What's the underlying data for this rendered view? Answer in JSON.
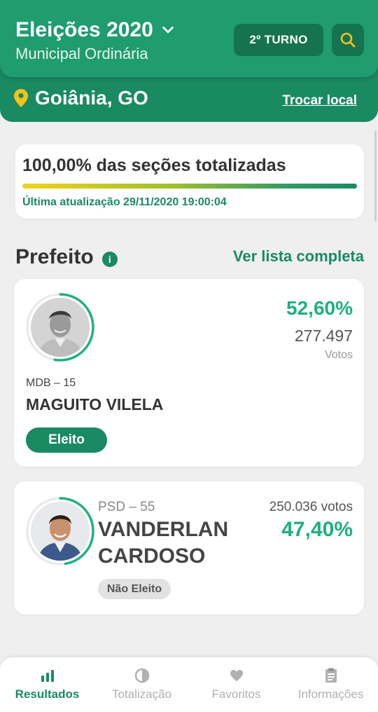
{
  "header": {
    "title": "Eleições 2020",
    "subtitle": "Municipal Ordinária",
    "turno_label": "2º TURNO",
    "location": "Goiânia, GO",
    "change_location": "Trocar local"
  },
  "totalization": {
    "title": "100,00% das seções totalizadas",
    "progress_percent": 100,
    "updated": "Última atualização 29/11/2020 19:00:04"
  },
  "section": {
    "title": "Prefeito",
    "see_all": "Ver lista completa"
  },
  "candidates": [
    {
      "party": "MDB – 15",
      "name": "MAGUITO VILELA",
      "percent": "52,60%",
      "percent_value": 52.6,
      "votes": "277.497",
      "votes_label": "Votos",
      "status": "Eleito"
    },
    {
      "party": "PSD – 55",
      "name": "VANDERLAN CARDOSO",
      "percent": "47,40%",
      "percent_value": 47.4,
      "votes": "250.036 votos",
      "status": "Não Eleito"
    }
  ],
  "nav": {
    "items": [
      {
        "label": "Resultados",
        "icon": "bar-chart-icon",
        "active": true
      },
      {
        "label": "Totalização",
        "icon": "pie-chart-icon",
        "active": false
      },
      {
        "label": "Favoritos",
        "icon": "heart-icon",
        "active": false
      },
      {
        "label": "Informações",
        "icon": "clipboard-icon",
        "active": false
      }
    ]
  },
  "colors": {
    "brand_green": "#1a8a63",
    "header_green": "#1f9c70",
    "percent_green": "#1fb07f",
    "location_pin": "#f3c21b"
  }
}
